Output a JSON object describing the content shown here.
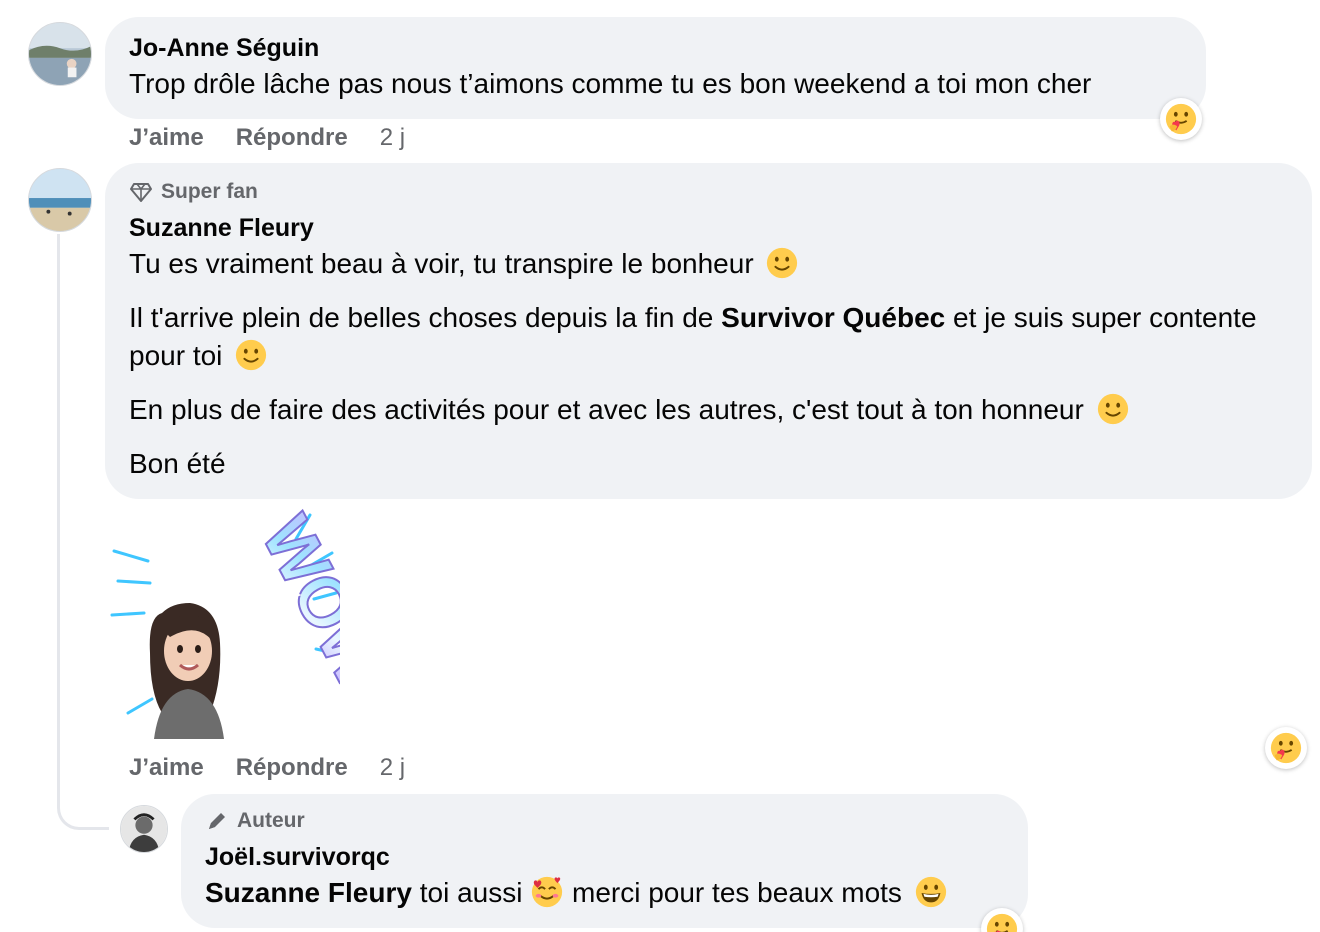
{
  "comments": [
    {
      "author": "Jo-Anne Séguin",
      "text": "Trop drôle lâche pas nous t’aimons comme tu es bon weekend a toi mon cher",
      "like_label": "J’aime",
      "reply_label": "Répondre",
      "time": "2 j"
    },
    {
      "badge": "Super fan",
      "author": "Suzanne Fleury",
      "p1": "Tu es vraiment beau à voir, tu transpire le bonheur",
      "p2_before": "Il t'arrive plein de belles choses depuis la fin de ",
      "p2_bold": "Survivor Québec",
      "p2_after": " et je suis super contente pour toi",
      "p3": "En plus de faire des activités pour et avec les autres, c'est tout à ton honneur",
      "p4": "Bon été",
      "sticker_text": "WOW",
      "like_label": "J’aime",
      "reply_label": "Répondre",
      "time": "2 j"
    },
    {
      "badge": "Auteur",
      "author": "Joël.survivorqc",
      "mention": "Suzanne Fleury",
      "text_a": " toi aussi ",
      "text_b": " merci pour tes beaux mots"
    }
  ],
  "icons": {
    "super_fan": "diamond-icon",
    "author": "pencil-icon",
    "reaction": "care-hug-emoji",
    "smile": "slightly-smiling-emoji",
    "hearts": "smiling-face-with-hearts-emoji",
    "grin": "grinning-face-emoji"
  },
  "colors": {
    "bubble": "#f0f2f5",
    "muted_text": "#65676b",
    "emoji_yellow": "#ffcc4d"
  }
}
